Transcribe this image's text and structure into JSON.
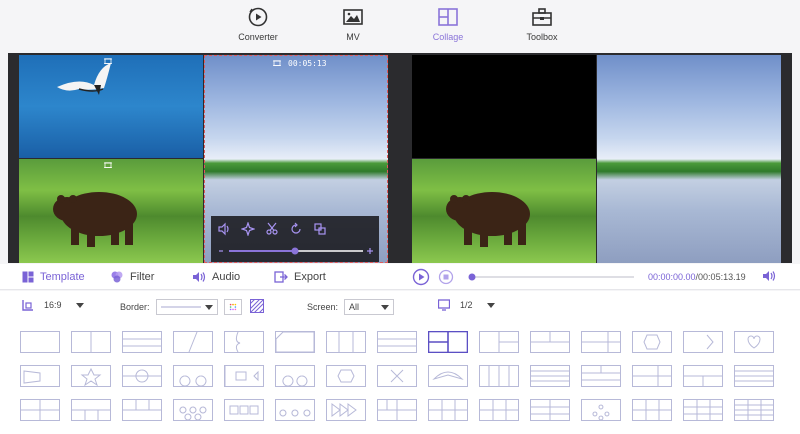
{
  "nav": {
    "items": [
      {
        "label": "Converter",
        "icon": "converter-icon"
      },
      {
        "label": "MV",
        "icon": "mv-icon"
      },
      {
        "label": "Collage",
        "icon": "collage-icon"
      },
      {
        "label": "Toolbox",
        "icon": "toolbox-icon"
      }
    ],
    "active": "Collage"
  },
  "preview": {
    "selected_cell_time": "00:05:13"
  },
  "tabs": {
    "template": "Template",
    "filter": "Filter",
    "audio": "Audio",
    "export": "Export"
  },
  "playback": {
    "current": "00:00:00.00",
    "total": "/00:05:13.19",
    "progress": 0.0
  },
  "settings": {
    "ratio": "16:9",
    "border_label": "Border:",
    "screen_label": "Screen:",
    "screen_value": "All",
    "page": "1/2"
  },
  "colors": {
    "accent": "#8a74d9",
    "template_stroke": "#b7b9d8",
    "template_active": "#5b4fc4",
    "selection_dash": "#e05a5a"
  },
  "templates": {
    "rows": 3,
    "per_row": 15,
    "active_index": 8
  }
}
